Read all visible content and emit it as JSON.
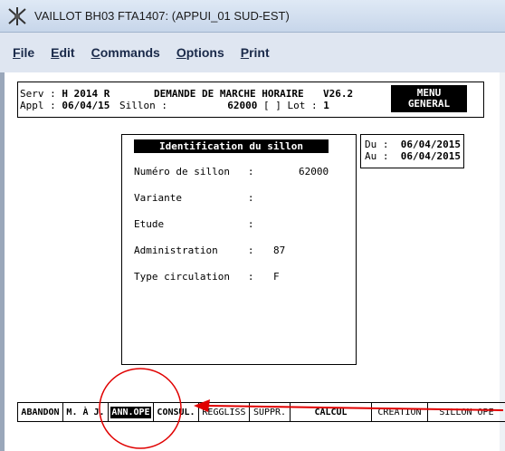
{
  "window": {
    "title": "VAILLOT BH03 FTA1407: (APPUI_01  SUD-EST)"
  },
  "menubar": {
    "items": [
      {
        "accel": "F",
        "rest": "ile"
      },
      {
        "accel": "E",
        "rest": "dit"
      },
      {
        "accel": "C",
        "rest": "ommands"
      },
      {
        "accel": "O",
        "rest": "ptions"
      },
      {
        "accel": "P",
        "rest": "rint"
      }
    ]
  },
  "header": {
    "serv_label": "Serv : ",
    "serv_value": "H 2014 R",
    "appl_label": "Appl : ",
    "appl_value": "06/04/15",
    "title": "DEMANDE DE MARCHE HORAIRE",
    "version": "V26.2",
    "sillon_label": "Sillon :",
    "sillon_value": "62000",
    "sillon_suffix": " [ ] Lot : ",
    "lot_value": "1",
    "menu_general_line1": "MENU",
    "menu_general_line2": "GENERAL"
  },
  "identification": {
    "title": "Identification du sillon",
    "fields": [
      {
        "label": "Numéro de sillon   :",
        "value": "62000"
      },
      {
        "label": "Variante           :",
        "value": ""
      },
      {
        "label": "Etude              :",
        "value": ""
      },
      {
        "label": "Administration     :",
        "value": "87"
      },
      {
        "label": "Type circulation   :",
        "value": "F"
      }
    ]
  },
  "dates": {
    "du_label": "Du :",
    "du_value": "06/04/2015",
    "au_label": "Au :",
    "au_value": "06/04/2015"
  },
  "function_keys": [
    {
      "label": "ABANDON",
      "style": "bold"
    },
    {
      "label": "M. À J.",
      "style": "bold"
    },
    {
      "label": "ANN.OPE",
      "style": "highlight"
    },
    {
      "label": "CONSUL.",
      "style": "bold"
    },
    {
      "label": "REGGLISS",
      "style": "normal"
    },
    {
      "label": "SUPPR.",
      "style": "normal"
    },
    {
      "label": "CALCUL",
      "style": "bold"
    },
    {
      "label": "CREATION",
      "style": "normal"
    },
    {
      "label": "SILLON OPE",
      "style": "normal"
    }
  ],
  "annotations": {
    "color": "#e00000"
  }
}
